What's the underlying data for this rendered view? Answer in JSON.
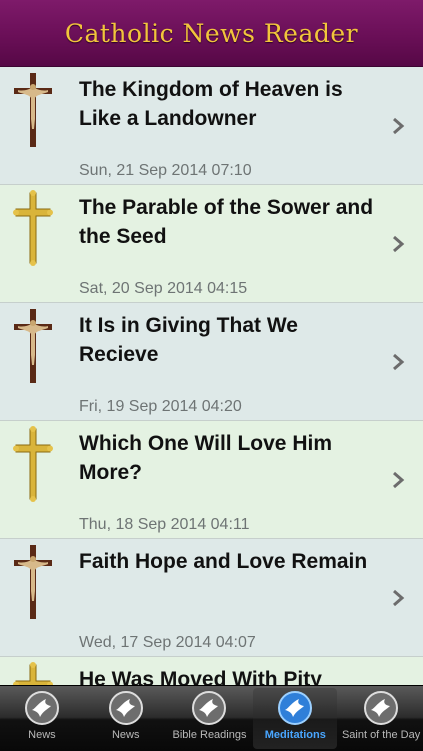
{
  "header": {
    "title": "Catholic News Reader"
  },
  "items": [
    {
      "title": "The Kingdom of Heaven is Like a Landowner",
      "date": "Sun, 21 Sep 2014 07:10",
      "icon": "crucifix-icon"
    },
    {
      "title": "The Parable of the Sower and the Seed",
      "date": "Sat, 20 Sep 2014 04:15",
      "icon": "gold-cross-icon"
    },
    {
      "title": "It Is in Giving That We Recieve",
      "date": "Fri, 19 Sep 2014 04:20",
      "icon": "crucifix-icon"
    },
    {
      "title": "Which One Will Love Him More?",
      "date": "Thu, 18 Sep 2014 04:11",
      "icon": "gold-cross-icon"
    },
    {
      "title": "Faith Hope and Love Remain",
      "date": "Wed, 17 Sep 2014 04:07",
      "icon": "crucifix-icon"
    },
    {
      "title": "He Was Moved With Pity",
      "date": "",
      "icon": "gold-cross-icon"
    }
  ],
  "tabs": [
    {
      "label": "News",
      "icon": "dove-icon",
      "active": false
    },
    {
      "label": "News",
      "icon": "dove-icon",
      "active": false
    },
    {
      "label": "Bible Readings",
      "icon": "dove-icon",
      "active": false
    },
    {
      "label": "Meditations",
      "icon": "dove-icon",
      "active": true
    },
    {
      "label": "Saint of the Day",
      "icon": "dove-icon",
      "active": false
    }
  ],
  "colors": {
    "header": "#6a0f57",
    "title_gold": "#f2c53c",
    "active_tab": "#49a6ff"
  }
}
